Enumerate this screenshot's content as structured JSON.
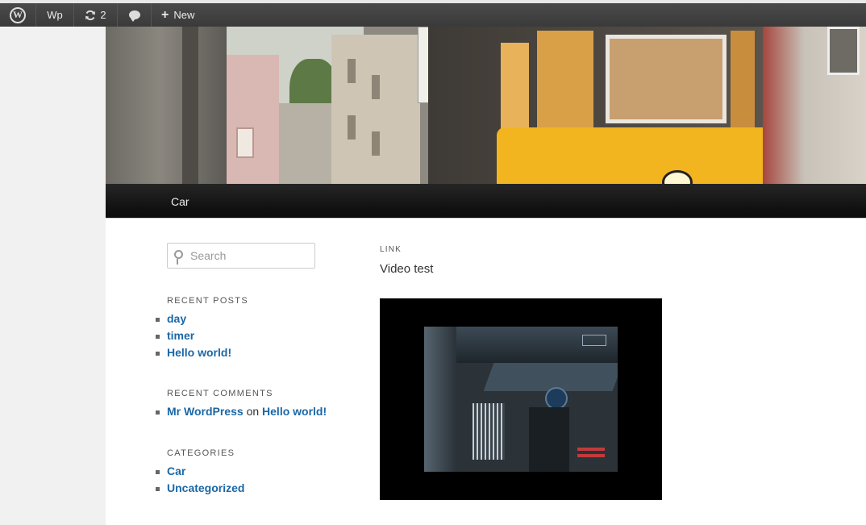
{
  "admin_bar": {
    "site_name": "Wp",
    "updates_count": "2",
    "new_label": "New",
    "icons": [
      "wordpress-logo-icon",
      "updates-icon",
      "comments-icon",
      "plus-icon"
    ]
  },
  "nav": {
    "items": [
      "Car"
    ]
  },
  "sidebar": {
    "search_placeholder": "Search",
    "recent_posts": {
      "title": "RECENT POSTS",
      "items": [
        "day",
        "timer",
        "Hello world!"
      ]
    },
    "recent_comments": {
      "title": "RECENT COMMENTS",
      "author": "Mr WordPress",
      "on": "on",
      "post": "Hello world!"
    },
    "categories": {
      "title": "CATEGORIES",
      "items": [
        "Car",
        "Uncategorized"
      ]
    }
  },
  "post": {
    "format": "LINK",
    "title": "Video test"
  },
  "colors": {
    "admin_bar": "#464646",
    "link": "#1b67a6",
    "nav": "#111111",
    "tram_yellow": "#f2b51f"
  }
}
